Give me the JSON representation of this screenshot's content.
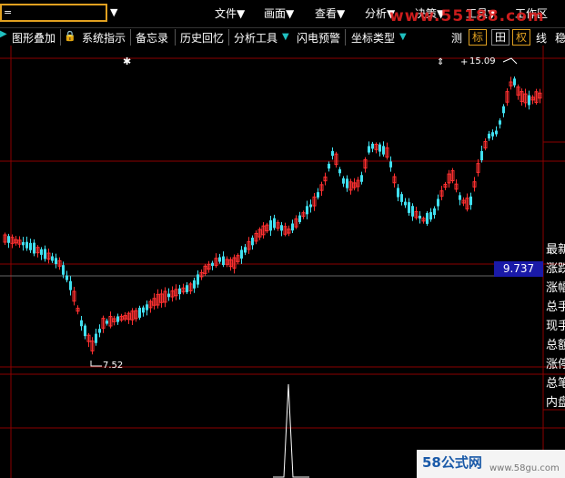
{
  "menubar": {
    "search_value": "=",
    "items": [
      "文件▼",
      "画面▼",
      "查看▼",
      "分析▼",
      "决策▼",
      "工具▼",
      "工作区"
    ]
  },
  "toolbar": {
    "overlay": "图形叠加",
    "indicator": "系统指示",
    "memo": "备忘录",
    "history": "历史回忆",
    "analysis": "分析工具",
    "flash": "闪电预警",
    "coord": "坐标类型",
    "btn_measure": "测",
    "btn_mark": "标",
    "btn_grid": "田",
    "btn_right": "权",
    "btn_line": "线",
    "btn_more": "稳"
  },
  "chart": {
    "high_label": "15.09",
    "low_label": "7.52",
    "current_price": "9.737"
  },
  "right_panel": [
    "最新",
    "涨跌",
    "涨幅",
    "总手",
    "现手",
    "总额",
    "涨停",
    "总笔",
    "内盘"
  ],
  "watermark": {
    "top": "www.55188.com",
    "bottom_logo": "58公式网",
    "bottom_url": "www.58gu.com"
  },
  "colors": {
    "up": "#ff3030",
    "down": "#40e0f0",
    "grid": "#8b0000",
    "current_line": "#666666"
  }
}
